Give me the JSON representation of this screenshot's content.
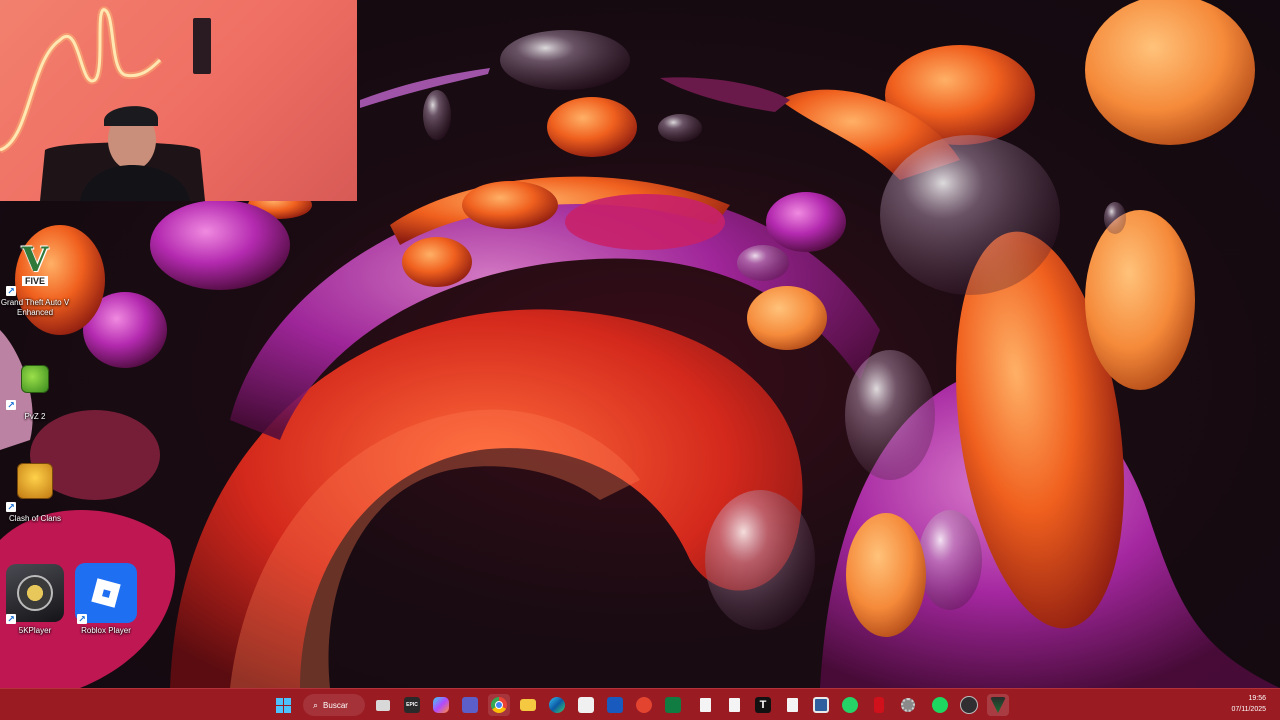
{
  "desktop_icons": [
    {
      "label": "Grand Theft Auto V Enhanced",
      "icon": "gta-v-icon"
    },
    {
      "label": "PvZ 2",
      "icon": "pvz2-icon"
    },
    {
      "label": "Clash of Clans",
      "icon": "clash-of-clans-icon"
    },
    {
      "label": "5KPlayer",
      "icon": "5kplayer-icon"
    },
    {
      "label": "Roblox Player",
      "icon": "roblox-icon"
    }
  ],
  "gta_logo_text": "V",
  "gta_logo_sub": "FIVE",
  "search": {
    "label": "Buscar"
  },
  "taskbar": {
    "apps": [
      "task-view-icon",
      "epic-games-icon",
      "copilot-icon",
      "teams-icon",
      "chrome-icon",
      "file-explorer-icon",
      "edge-icon",
      "microsoft-store-icon",
      "word-icon",
      "office-icon",
      "excel-icon",
      "document-icon",
      "document-icon",
      "tiktok-icon",
      "document-icon",
      "app-icon",
      "whatsapp-icon",
      "red-app-icon",
      "settings-icon",
      "spotify-icon",
      "obs-icon",
      "shield-app-icon"
    ],
    "epic_label": "EPIC",
    "tiktok_label": "T"
  },
  "clock": {
    "time": "19:56",
    "date": "07/11/2025"
  },
  "colors": {
    "taskbar": "#9a1b22",
    "accent": "#f2806e"
  }
}
